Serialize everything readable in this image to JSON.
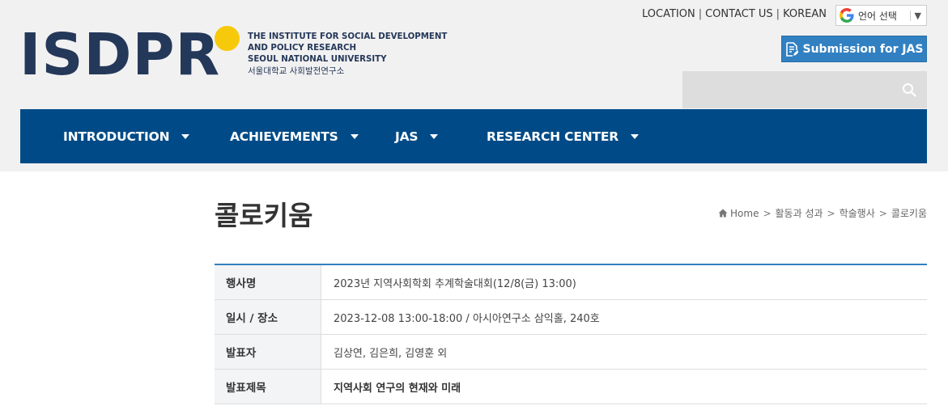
{
  "logo": {
    "name": "ISDPR",
    "subtitle_lines": [
      "THE INSTITUTE FOR SOCIAL DEVELOPMENT",
      "AND POLICY RESEARCH",
      "SEOUL NATIONAL UNIVERSITY"
    ],
    "korean": "서울대학교 사회발전연구소"
  },
  "top_links": [
    "LOCATION",
    "CONTACT US",
    "KOREAN"
  ],
  "translate": {
    "label": "언어 선택",
    "arrow": "▼"
  },
  "submission_button": "Submission for JAS",
  "search": {
    "placeholder": ""
  },
  "nav": [
    "INTRODUCTION",
    "ACHIEVEMENTS",
    "JAS",
    "RESEARCH CENTER"
  ],
  "page": {
    "title": "콜로키움",
    "breadcrumb": [
      "Home",
      "활동과 성과",
      "학술행사",
      "콜로키움"
    ]
  },
  "details": [
    {
      "label": "행사명",
      "value": "2023년 지역사회학회 추계학술대회(12/8(금) 13:00)"
    },
    {
      "label": "일시 / 장소",
      "value": "2023-12-08 13:00-18:00 / 아시아연구소 삼익홀, 240호"
    },
    {
      "label": "발표자",
      "value": "김상연, 김은희, 김영훈 외"
    },
    {
      "label": "발표제목",
      "value": "지역사회 연구의 현재와 미래"
    }
  ],
  "colors": {
    "nav_bg": "#004b87",
    "accent": "#3180c2",
    "logo_dot": "#f7c90b",
    "logo_text": "#243859"
  }
}
